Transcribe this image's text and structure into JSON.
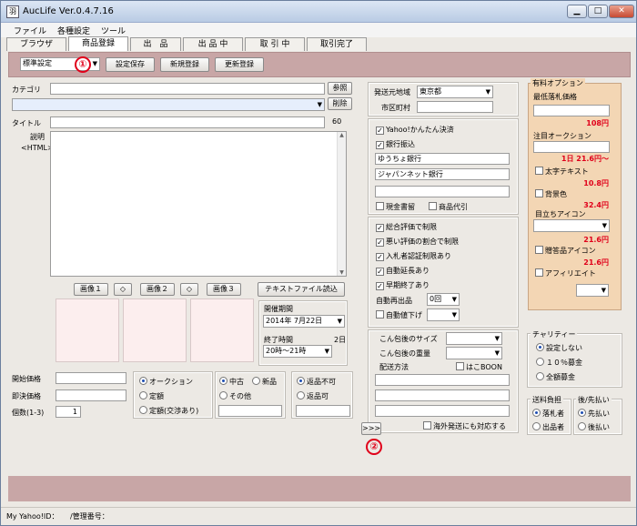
{
  "window": {
    "title": "AucLife Ver.0.4.7.16",
    "icon": "羽",
    "minimize": "▁",
    "maximize": "□",
    "close": "✕"
  },
  "menu": [
    "ファイル",
    "各種設定",
    "ツール"
  ],
  "tabs": [
    "ブラウザ",
    "商品登録",
    "出　品",
    "出 品 中",
    "取 引 中",
    "取引完了"
  ],
  "toolbar": {
    "preset": "標準設定",
    "save": "設定保存",
    "new": "新規登録",
    "update": "更新登録",
    "badge1": "①"
  },
  "category": {
    "label": "カテゴリ",
    "browse": "参照",
    "delete": "削除"
  },
  "title": {
    "label": "タイトル",
    "count": "60"
  },
  "description": {
    "label": "説明",
    "sub": "<HTML>"
  },
  "images": {
    "img1": "画像１",
    "img2": "画像２",
    "img3": "画像３",
    "swap": "◇",
    "textfile": "テキストファイル読込"
  },
  "period": {
    "label": "開催期間",
    "date": "2014年 7月22日",
    "end_label": "終了時間",
    "days": "2日",
    "end_time": "20時～21時"
  },
  "prices": {
    "start": "開始価格",
    "buyout": "即決価格",
    "qty": "個数(1-3)",
    "qty_value": "1"
  },
  "format": {
    "auction": "オークション",
    "fixed": "定額",
    "fixed_nego": "定額(交渉あり)"
  },
  "condition": {
    "used": "中古",
    "new": "新品",
    "other": "その他"
  },
  "returns": {
    "no": "返品不可",
    "yes": "返品可"
  },
  "shipping": {
    "origin_label": "発送元地域",
    "origin": "東京都",
    "city_label": "市区町村"
  },
  "payment": {
    "yahoo": "Yahoo!かんたん決済",
    "bank": "銀行振込",
    "bank1": "ゆうちょ銀行",
    "bank2": "ジャパンネット銀行",
    "cash": "現金書留",
    "cod": "商品代引"
  },
  "options": {
    "total_limit": "総合評価で制限",
    "bad_ratio": "悪い評価の割合で制限",
    "bidder_auth": "入札者認証制限あり",
    "auto_extend": "自動延長あり",
    "early_end": "早期終了あり",
    "relist_label": "自動再出品",
    "relist": "0回",
    "auto_down": "自動値下げ"
  },
  "package": {
    "size": "こん包後のサイズ",
    "weight": "こん包後の重量",
    "method": "配送方法",
    "hako": "はこBOON",
    "overseas": "海外発送にも対応する",
    "expand": ">>>",
    "badge2": "②"
  },
  "paid_options": {
    "title": "有料オプション",
    "min_price": "最低落札価格",
    "min_price_cost": "108円",
    "featured": "注目オークション",
    "featured_cost": "1日 21.6円～",
    "bold": "太字テキスト",
    "bold_cost": "10.8円",
    "bg": "背景色",
    "bg_cost": "32.4円",
    "icon": "目立ちアイコン",
    "icon_cost": "21.6円",
    "gift": "贈答品アイコン",
    "gift_cost": "21.6円",
    "affiliate": "アフィリエイト"
  },
  "charity": {
    "title": "チャリティー",
    "none": "設定しない",
    "ten": "１０％募金",
    "all": "全額募金"
  },
  "postage": {
    "title": "送料負担",
    "buyer": "落札者",
    "seller": "出品者"
  },
  "pay_timing": {
    "title": "後/先払い",
    "pre": "先払い",
    "post": "後払い"
  },
  "status": {
    "yahoo_id": "My Yahoo!ID：",
    "manage_no": "/管理番号："
  },
  "colors": {
    "pink": "#c8a6a6",
    "orange": "#f3d6b4",
    "red": "#e0001a"
  }
}
